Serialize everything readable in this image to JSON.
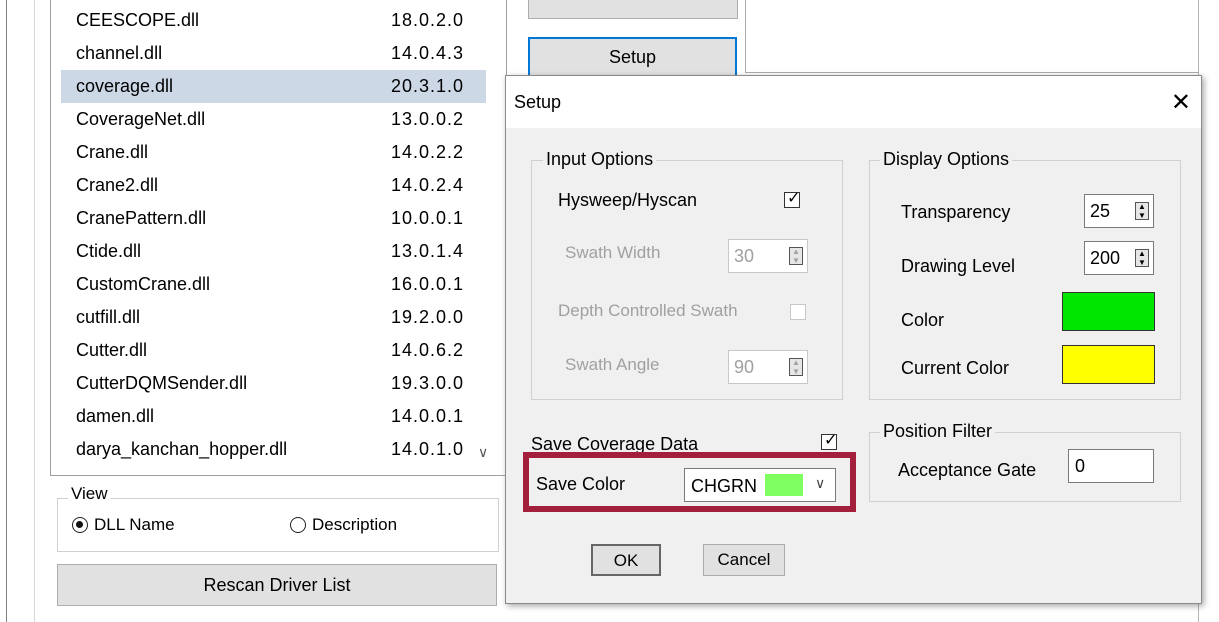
{
  "driver_list": [
    {
      "name": "CEESCOPE.dll",
      "version": "18.0.2.0",
      "selected": false
    },
    {
      "name": "channel.dll",
      "version": "14.0.4.3",
      "selected": false
    },
    {
      "name": "coverage.dll",
      "version": "20.3.1.0",
      "selected": true
    },
    {
      "name": "CoverageNet.dll",
      "version": "13.0.0.2",
      "selected": false
    },
    {
      "name": "Crane.dll",
      "version": "14.0.2.2",
      "selected": false
    },
    {
      "name": "Crane2.dll",
      "version": "14.0.2.4",
      "selected": false
    },
    {
      "name": "CranePattern.dll",
      "version": "10.0.0.1",
      "selected": false
    },
    {
      "name": "Ctide.dll",
      "version": "13.0.1.4",
      "selected": false
    },
    {
      "name": "CustomCrane.dll",
      "version": "16.0.0.1",
      "selected": false
    },
    {
      "name": "cutfill.dll",
      "version": "19.2.0.0",
      "selected": false
    },
    {
      "name": "Cutter.dll",
      "version": "14.0.6.2",
      "selected": false
    },
    {
      "name": "CutterDQMSender.dll",
      "version": "19.3.0.0",
      "selected": false
    },
    {
      "name": "damen.dll",
      "version": "14.0.0.1",
      "selected": false
    },
    {
      "name": "darya_kanchan_hopper.dll",
      "version": "14.0.1.0",
      "selected": false
    }
  ],
  "view": {
    "legend": "View",
    "dll_name_label": "DLL Name",
    "description_label": "Description",
    "selected": "DLL Name"
  },
  "buttons": {
    "setup": "Setup",
    "rescan": "Rescan Driver List"
  },
  "dialog": {
    "title": "Setup",
    "close_icon": "close-icon",
    "input_options": {
      "legend": "Input Options",
      "hysweep_label": "Hysweep/Hyscan",
      "hysweep_checked": true,
      "swath_width_label": "Swath Width",
      "swath_width_value": "30",
      "depth_controlled_label": "Depth Controlled Swath",
      "depth_controlled_checked": false,
      "swath_angle_label": "Swath Angle",
      "swath_angle_value": "90"
    },
    "display_options": {
      "legend": "Display Options",
      "transparency_label": "Transparency",
      "transparency_value": "25",
      "drawing_level_label": "Drawing Level",
      "drawing_level_value": "200",
      "color_label": "Color",
      "color_value": "#00e600",
      "current_color_label": "Current Color",
      "current_color_value": "#ffff00"
    },
    "save_coverage": {
      "label": "Save Coverage Data",
      "checked": true
    },
    "save_color": {
      "label": "Save Color",
      "value": "CHGRN",
      "swatch": "#80ff60"
    },
    "position_filter": {
      "legend": "Position Filter",
      "acceptance_gate_label": "Acceptance Gate",
      "acceptance_gate_value": "0"
    },
    "ok_label": "OK",
    "cancel_label": "Cancel"
  },
  "colors": {
    "selection": "#ccd8e6",
    "highlight_box": "#a31f3b",
    "focus_border": "#0078d7"
  }
}
